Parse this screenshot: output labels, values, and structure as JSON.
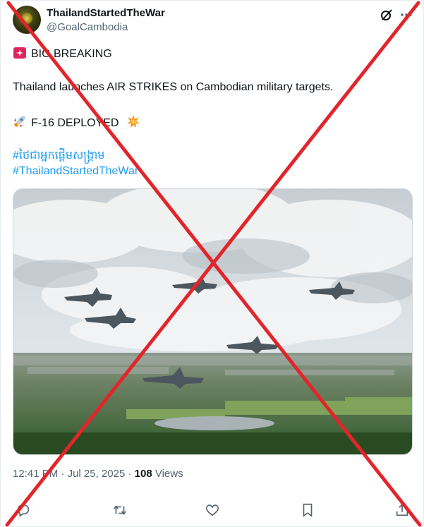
{
  "author": {
    "display_name": "ThailandStartedTheWar",
    "handle": "@GoalCambodia"
  },
  "tweet": {
    "line1": "BIG BREAKING",
    "line2": "Thailand launches AIR STRIKES on Cambodian military targets.",
    "line3": "F-16 DEPLOYED",
    "hashtag1": "#ថៃជាអ្នកផ្តើមសង្គ្រាម",
    "hashtag2": "#ThailandStartedTheWar"
  },
  "meta": {
    "time": "12:41 PM",
    "separator": "·",
    "date": "Jul 25, 2025",
    "views_count": "108",
    "views_label": "Views"
  },
  "icons": {
    "siren": "rotating-light-icon",
    "rocket": "rocket-icon",
    "collision": "collision-icon",
    "grok": "grok-icon",
    "more": "more-icon",
    "reply": "reply-icon",
    "retweet": "retweet-icon",
    "like": "like-icon",
    "bookmark": "bookmark-icon",
    "share": "share-icon"
  },
  "colors": {
    "accent": "#1d9bf0",
    "text": "#0f1419",
    "secondary_text": "#536471",
    "cross_overlay": "#e2252b"
  }
}
